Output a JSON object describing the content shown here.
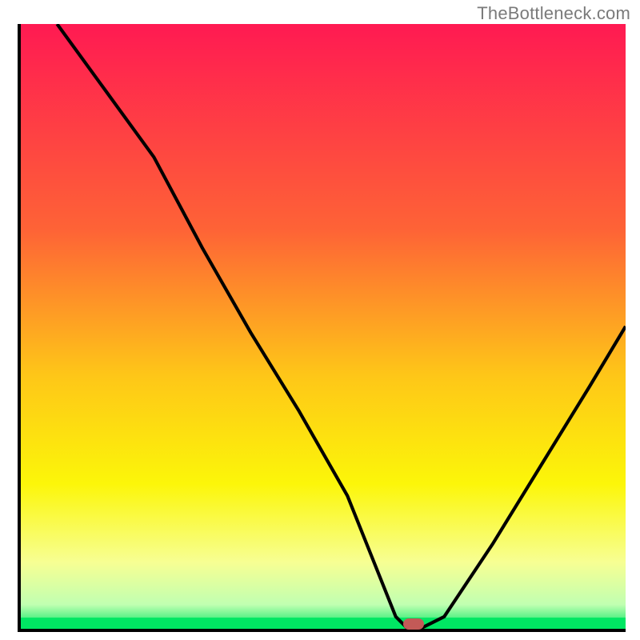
{
  "attribution": "TheBottleneck.com",
  "colors": {
    "axis": "#000000",
    "curve": "#000000",
    "marker": "#c35a57",
    "gradient_stops": [
      {
        "pct": 0,
        "color": "#ff1a52"
      },
      {
        "pct": 34,
        "color": "#fe6336"
      },
      {
        "pct": 58,
        "color": "#fec618"
      },
      {
        "pct": 76,
        "color": "#fcf609"
      },
      {
        "pct": 89,
        "color": "#f7ff93"
      },
      {
        "pct": 96,
        "color": "#c1ffb1"
      },
      {
        "pct": 100,
        "color": "#00e763"
      }
    ],
    "green_band": "#00e763"
  },
  "chart_data": {
    "type": "line",
    "title": "",
    "xlabel": "",
    "ylabel": "",
    "xlim": [
      0,
      100
    ],
    "ylim": [
      0,
      100
    ],
    "series": [
      {
        "name": "bottleneck-curve",
        "x": [
          6,
          14,
          22,
          30,
          38,
          46,
          54,
          58,
          62,
          64,
          66,
          70,
          78,
          86,
          94,
          100
        ],
        "y": [
          100,
          89,
          78,
          63,
          49,
          36,
          22,
          12,
          2,
          0,
          0,
          2,
          14,
          27,
          40,
          50
        ]
      }
    ],
    "marker": {
      "x": 65,
      "y": 0.8
    },
    "annotation": "TheBottleneck.com"
  }
}
